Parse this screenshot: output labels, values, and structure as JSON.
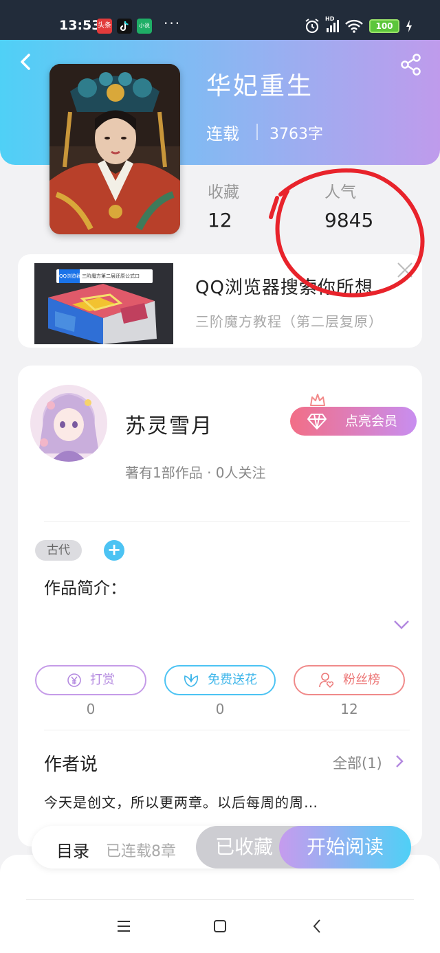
{
  "status_bar": {
    "time": "13:53",
    "apps": [
      "头条",
      "抖音",
      "小说"
    ],
    "more": "···",
    "network": "HD",
    "battery": "100"
  },
  "book": {
    "title": "华妃重生",
    "status": "连载",
    "word_count": "3763字",
    "stats": [
      {
        "label": "收藏",
        "value": "12"
      },
      {
        "label": "人气",
        "value": "9845"
      }
    ]
  },
  "ad": {
    "title": "QQ浏览器搜索你所想",
    "subtitle": "三阶魔方教程（第二层复原）",
    "search_text": "三阶魔方第二层还原公式口",
    "brand": "QQ浏览器"
  },
  "author": {
    "name": "苏灵雪月",
    "meta": "著有1部作品 · 0人关注",
    "vip_label": "点亮会员"
  },
  "tags": [
    "古代"
  ],
  "tag_add": "+",
  "intro_label": "作品简介：",
  "actions": [
    {
      "label": "打赏",
      "count": "0",
      "color": "#c59be8",
      "icon": "coin-icon"
    },
    {
      "label": "免费送花",
      "count": "0",
      "color": "#4cc3f3",
      "icon": "flower-icon"
    },
    {
      "label": "粉丝榜",
      "count": "12",
      "color": "#f08a8a",
      "icon": "fan-icon"
    }
  ],
  "author_says": {
    "label": "作者说",
    "all_label": "全部(1)",
    "text": "今天是创文，所以更两章。以后每周的周…"
  },
  "bottom": {
    "toc_label": "目录",
    "toc_count": "已连载8章",
    "favorited_label": "已收藏",
    "read_label": "开始阅读"
  },
  "colors": {
    "header_start": "#4fd0f6",
    "header_end": "#bf9bec",
    "annotation": "#e8232b"
  }
}
